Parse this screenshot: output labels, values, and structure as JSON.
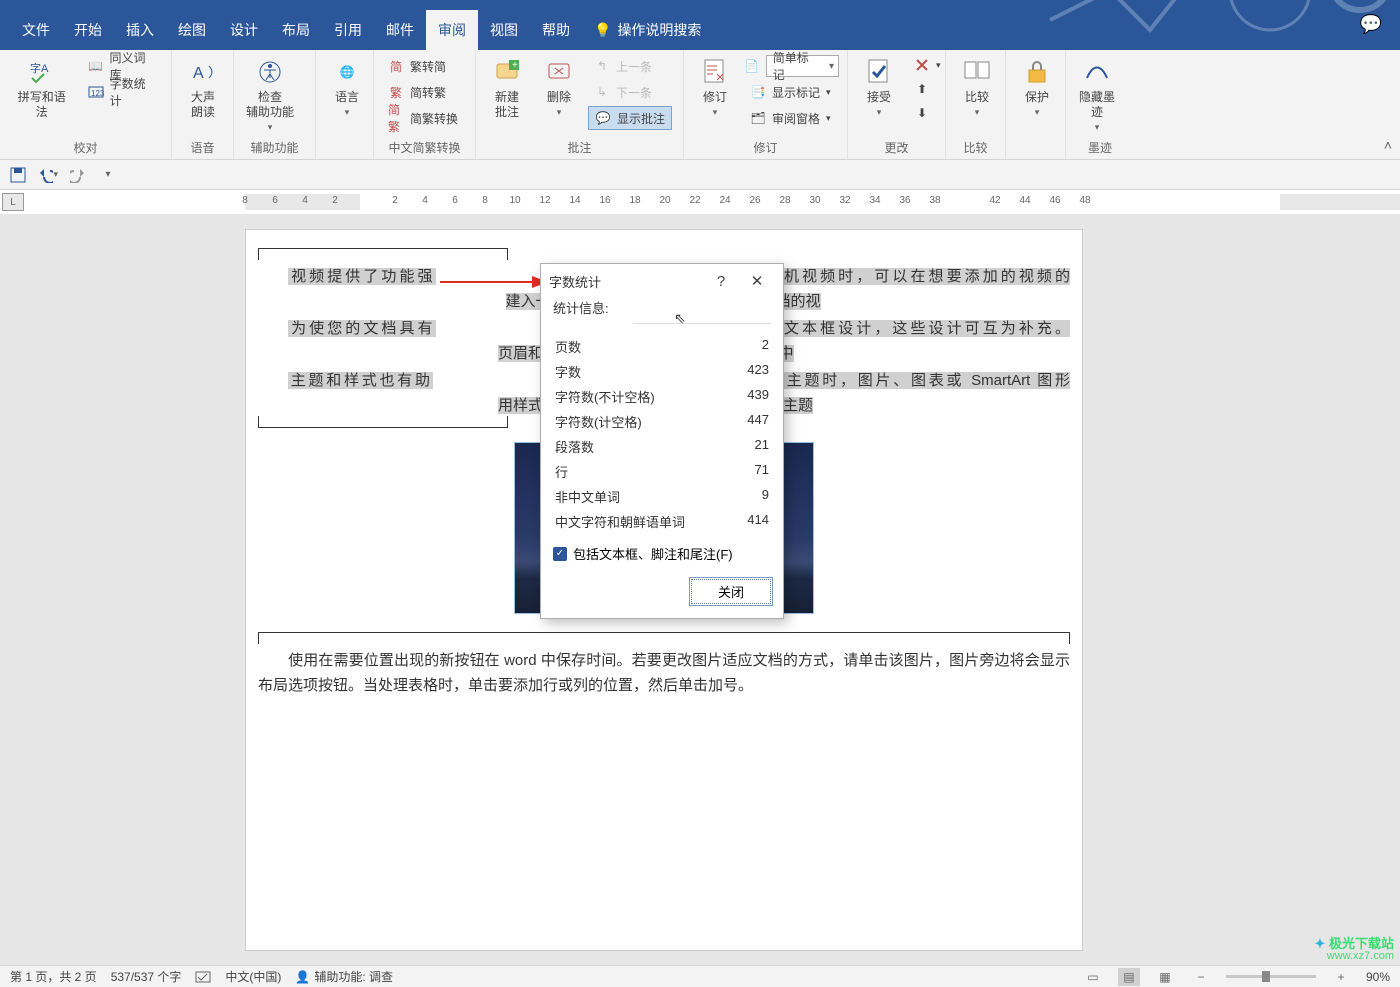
{
  "tabs": {
    "file": "文件",
    "home": "开始",
    "insert": "插入",
    "draw": "绘图",
    "design": "设计",
    "layout": "布局",
    "references": "引用",
    "mailings": "邮件",
    "review": "审阅",
    "view": "视图",
    "help": "帮助",
    "tell_me": "操作说明搜索"
  },
  "ribbon": {
    "proofing": {
      "spelling": "拼写和语法",
      "thesaurus": "同义词库",
      "wordcount": "字数统计",
      "label": "校对"
    },
    "speech": {
      "read_aloud": "大声\n朗读",
      "label": "语音"
    },
    "accessibility": {
      "check": "检查\n辅助功能",
      "label": "辅助功能"
    },
    "language": {
      "language": "语言",
      "label": ""
    },
    "ctc": {
      "t2s": "繁转简",
      "s2t": "简转繁",
      "convert": "简繁转换",
      "label": "中文简繁转换"
    },
    "comments": {
      "new": "新建\n批注",
      "delete": "删除",
      "prev": "上一条",
      "next": "下一条",
      "show": "显示批注",
      "label": "批注"
    },
    "tracking": {
      "track": "修订",
      "display_mode": "简单标记",
      "show_markup": "显示标记",
      "reviewing_pane": "审阅窗格",
      "label": "修订"
    },
    "changes": {
      "accept": "接受",
      "label": "更改"
    },
    "compare": {
      "compare": "比较",
      "label": "比较"
    },
    "protect": {
      "protect": "保护",
      "label": ""
    },
    "ink": {
      "hide": "隐藏墨\n迹",
      "label": "墨迹"
    }
  },
  "ruler_ticks": [
    "8",
    "6",
    "4",
    "2",
    "",
    "2",
    "4",
    "6",
    "8",
    "10",
    "12",
    "14",
    "16",
    "18",
    "20",
    "22",
    "24",
    "26",
    "28",
    "30",
    "32",
    "34",
    "36",
    "38",
    "",
    "42",
    "44",
    "46",
    "48"
  ],
  "dialog": {
    "title": "字数统计",
    "section": "统计信息:",
    "rows": [
      {
        "k": "页数",
        "v": "2"
      },
      {
        "k": "字数",
        "v": "423"
      },
      {
        "k": "字符数(不计空格)",
        "v": "439"
      },
      {
        "k": "字符数(计空格)",
        "v": "447"
      },
      {
        "k": "段落数",
        "v": "21"
      },
      {
        "k": "行",
        "v": "71"
      },
      {
        "k": "非中文单词",
        "v": "9"
      },
      {
        "k": "中文字符和朝鲜语单词",
        "v": "414"
      }
    ],
    "checkbox": "包括文本框、脚注和尾注(F)",
    "close": "关闭"
  },
  "document": {
    "p1a": "视频提供了功能强",
    "p1b": "当您单击联机视频时，可以在想要添加的视频的",
    "p1c": "建入一个关键字以联机搜索最适合您的文档的视",
    "p2a": "为使您的文档具有",
    "p2b": "脚、封面和文本框设计，这些设计可互为补充。",
    "p2c": "页眉和提要栏。单击\"插入\"，然后从不同库中",
    "p3a": "主题和样式也有助",
    "p3b": "片选择新的主题时，图片、图表或 SmartArt 图形",
    "p3c": "用样式时，您的标题会进行更改以匹配新的主题",
    "p4": "使用在需要位置出现的新按钮在 word 中保存时间。若要更改图片适应文档的方式，请单击该图片，图片旁边将会显示布局选项按钮。当处理表格时，单击要添加行或列的位置，然后单击加号。"
  },
  "statusbar": {
    "page": "第 1 页，共 2 页",
    "words": "537/537 个字",
    "lang": "中文(中国)",
    "a11y": "辅助功能: 调查",
    "zoom": "90%"
  },
  "watermark": {
    "l1": "极光下载站",
    "l2": "www.xz7.com"
  }
}
